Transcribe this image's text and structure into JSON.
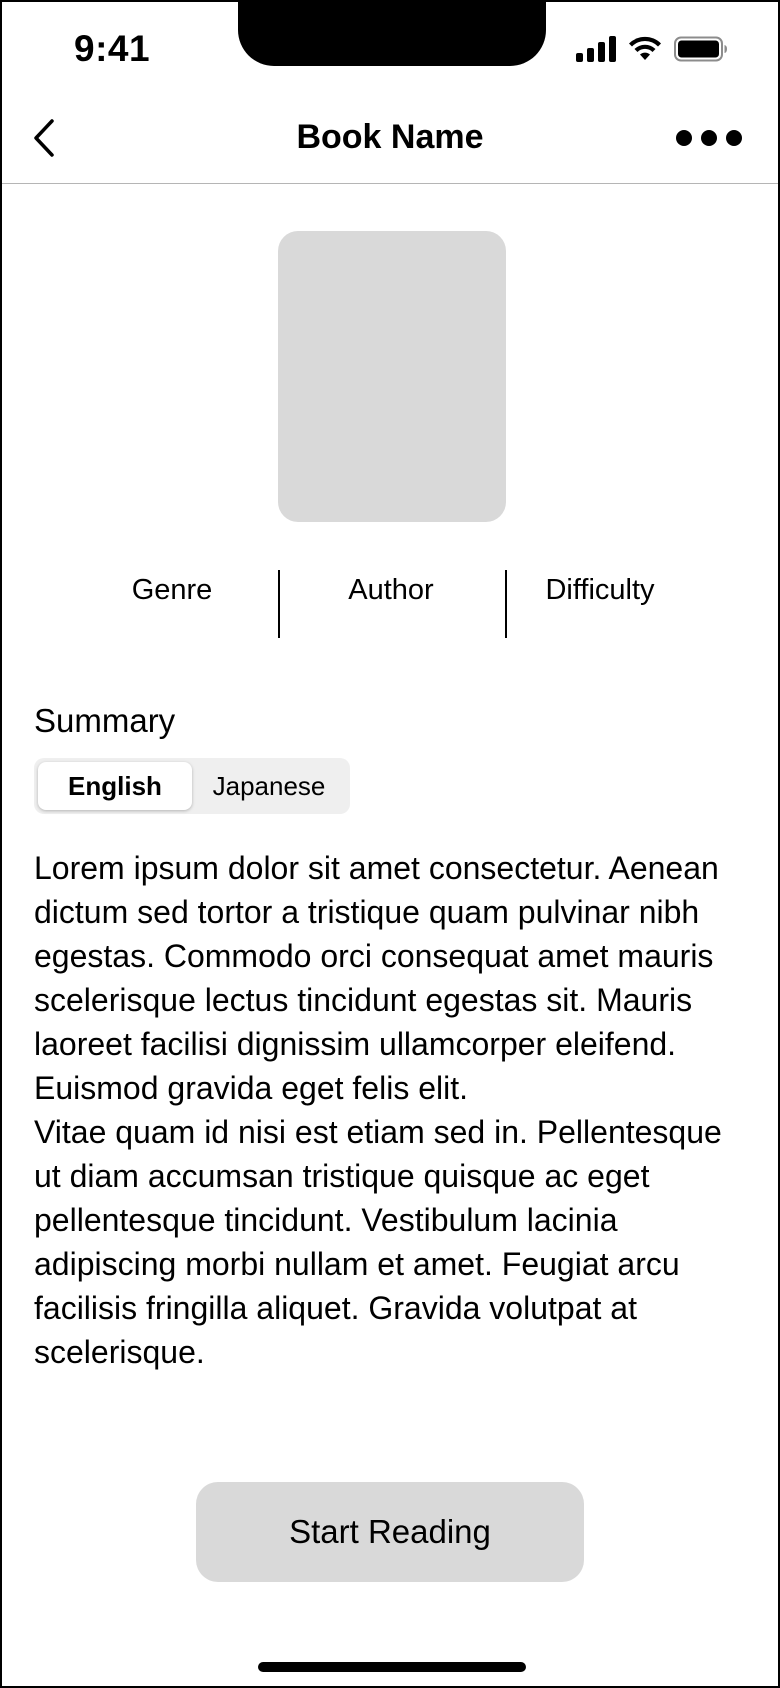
{
  "status_bar": {
    "time": "9:41",
    "icons": [
      "signal-icon",
      "wifi-icon",
      "battery-icon"
    ]
  },
  "nav": {
    "title": "Book Name",
    "back_icon": "chevron-left-icon",
    "more_icon": "ellipsis-icon"
  },
  "meta": {
    "genre": "Genre",
    "author": "Author",
    "difficulty": "Difficulty"
  },
  "summary": {
    "heading": "Summary",
    "tabs": [
      {
        "label": "English",
        "selected": true
      },
      {
        "label": "Japanese",
        "selected": false
      }
    ],
    "paragraphs": [
      "Lorem ipsum dolor sit amet consectetur. Aenean dictum sed tortor a tristique quam pulvinar nibh egestas. Commodo orci consequat amet mauris scelerisque lectus tincidunt egestas sit. Mauris laoreet facilisi dignissim ullamcorper eleifend. Euismod gravida eget felis elit.",
      "Vitae quam id nisi est etiam sed in. Pellentesque ut diam accumsan tristique quisque ac eget pellentesque tincidunt. Vestibulum lacinia adipiscing morbi nullam et amet. Feugiat arcu facilisis fringilla aliquet. Gravida volutpat at scelerisque."
    ]
  },
  "cta": {
    "label": "Start Reading"
  },
  "colors": {
    "placeholder_gray": "#d9d9d9",
    "segment_bg": "#efefef",
    "text": "#000000"
  }
}
